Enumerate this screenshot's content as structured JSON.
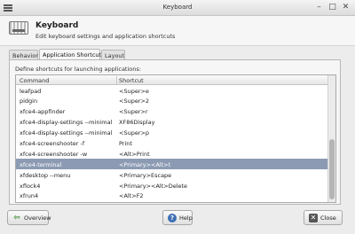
{
  "window": {
    "title": "Keyboard"
  },
  "header": {
    "title": "Keyboard",
    "subtitle": "Edit keyboard settings and application shortcuts"
  },
  "tabs": [
    {
      "label": "Behavior"
    },
    {
      "label": "Application Shortcuts"
    },
    {
      "label": "Layout"
    }
  ],
  "panel": {
    "label": "Define shortcuts for launching applications:"
  },
  "columns": {
    "command": "Command",
    "shortcut": "Shortcut"
  },
  "rows": [
    {
      "command": "leafpad",
      "shortcut": "<Super>e"
    },
    {
      "command": "pidgin",
      "shortcut": "<Super>2"
    },
    {
      "command": "xfce4-appfinder",
      "shortcut": "<Super>r"
    },
    {
      "command": "xfce4-display-settings --minimal",
      "shortcut": "XF86Display"
    },
    {
      "command": "xfce4-display-settings --minimal",
      "shortcut": "<Super>p"
    },
    {
      "command": "xfce4-screenshooter -f",
      "shortcut": "Print"
    },
    {
      "command": "xfce4-screenshooter -w",
      "shortcut": "<Alt>Print"
    },
    {
      "command": "xfce4-terminal",
      "shortcut": "<Primary><Alt>t"
    },
    {
      "command": "xfdesktop --menu",
      "shortcut": "<Primary>Escape"
    },
    {
      "command": "xflock4",
      "shortcut": "<Primary><Alt>Delete"
    },
    {
      "command": "xfrun4",
      "shortcut": "<Alt>F2"
    }
  ],
  "selected_row": "xfce4-terminal",
  "buttons": {
    "overview": "Overview",
    "help": "Help",
    "close": "Close"
  },
  "colors": {
    "selection": "#8c9bb3",
    "background": "#ececec"
  }
}
